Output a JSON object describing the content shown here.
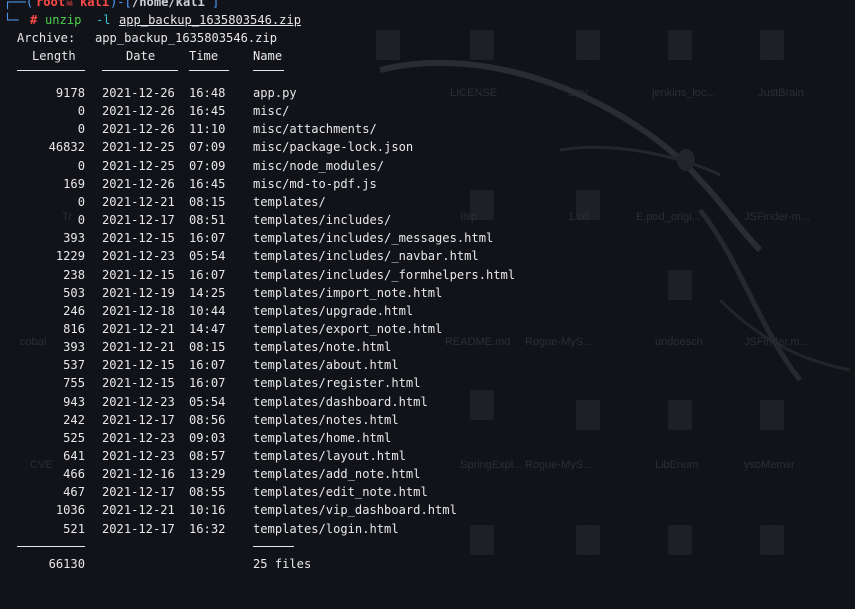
{
  "prompt": {
    "user": "root",
    "skull": "💀",
    "host": "kali",
    "path": "/home/kali",
    "symbol": "#",
    "command": "unzip",
    "flag": "-l",
    "arg": "app_backup_1635803546.zip"
  },
  "archive": {
    "label": "Archive:",
    "name": "app_backup_1635803546.zip"
  },
  "headers": {
    "length": "Length",
    "date": "Date",
    "time": "Time",
    "name": "Name"
  },
  "rows": [
    {
      "length": "9178",
      "date": "2021-12-26",
      "time": "16:48",
      "name": "app.py"
    },
    {
      "length": "0",
      "date": "2021-12-26",
      "time": "16:45",
      "name": "misc/"
    },
    {
      "length": "0",
      "date": "2021-12-26",
      "time": "11:10",
      "name": "misc/attachments/"
    },
    {
      "length": "46832",
      "date": "2021-12-25",
      "time": "07:09",
      "name": "misc/package-lock.json"
    },
    {
      "length": "0",
      "date": "2021-12-25",
      "time": "07:09",
      "name": "misc/node_modules/"
    },
    {
      "length": "169",
      "date": "2021-12-26",
      "time": "16:45",
      "name": "misc/md-to-pdf.js"
    },
    {
      "length": "0",
      "date": "2021-12-21",
      "time": "08:15",
      "name": "templates/"
    },
    {
      "length": "0",
      "date": "2021-12-17",
      "time": "08:51",
      "name": "templates/includes/"
    },
    {
      "length": "393",
      "date": "2021-12-15",
      "time": "16:07",
      "name": "templates/includes/_messages.html"
    },
    {
      "length": "1229",
      "date": "2021-12-23",
      "time": "05:54",
      "name": "templates/includes/_navbar.html"
    },
    {
      "length": "238",
      "date": "2021-12-15",
      "time": "16:07",
      "name": "templates/includes/_formhelpers.html"
    },
    {
      "length": "503",
      "date": "2021-12-19",
      "time": "14:25",
      "name": "templates/import_note.html"
    },
    {
      "length": "246",
      "date": "2021-12-18",
      "time": "10:44",
      "name": "templates/upgrade.html"
    },
    {
      "length": "816",
      "date": "2021-12-21",
      "time": "14:47",
      "name": "templates/export_note.html"
    },
    {
      "length": "393",
      "date": "2021-12-21",
      "time": "08:15",
      "name": "templates/note.html"
    },
    {
      "length": "537",
      "date": "2021-12-15",
      "time": "16:07",
      "name": "templates/about.html"
    },
    {
      "length": "755",
      "date": "2021-12-15",
      "time": "16:07",
      "name": "templates/register.html"
    },
    {
      "length": "943",
      "date": "2021-12-23",
      "time": "05:54",
      "name": "templates/dashboard.html"
    },
    {
      "length": "242",
      "date": "2021-12-17",
      "time": "08:56",
      "name": "templates/notes.html"
    },
    {
      "length": "525",
      "date": "2021-12-23",
      "time": "09:03",
      "name": "templates/home.html"
    },
    {
      "length": "641",
      "date": "2021-12-23",
      "time": "08:57",
      "name": "templates/layout.html"
    },
    {
      "length": "466",
      "date": "2021-12-16",
      "time": "13:29",
      "name": "templates/add_note.html"
    },
    {
      "length": "467",
      "date": "2021-12-17",
      "time": "08:55",
      "name": "templates/edit_note.html"
    },
    {
      "length": "1036",
      "date": "2021-12-21",
      "time": "10:16",
      "name": "templates/vip_dashboard.html"
    },
    {
      "length": "521",
      "date": "2021-12-17",
      "time": "16:32",
      "name": "templates/login.html"
    }
  ],
  "totals": {
    "length": "66130",
    "files": "25 files"
  },
  "desktop_labels": [
    "LICENSE",
    "s.py",
    "jenkins_loc...",
    "JustBrain",
    "Tr",
    "Ilsp",
    "1.txt",
    "E.pod_origi...",
    "JSFinder-m...",
    "cobal",
    "README.md",
    "Rogue-MyS...",
    "undoesch",
    "JSFinder.m...",
    "CVE",
    "SpringExpl...",
    "Rogue-MyS...",
    "LibEnum",
    "ysoMemsr"
  ],
  "colors": {
    "background": "#111318",
    "prompt_user": "#ff4a4a",
    "prompt_frame": "#4fa0ff",
    "command": "#4bd14b",
    "text": "#e8e8ea"
  }
}
